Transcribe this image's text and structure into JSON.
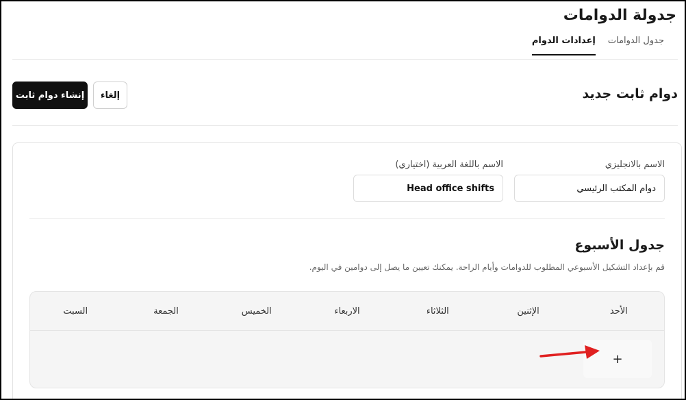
{
  "header": {
    "title": "جدولة الدوامات",
    "tabs": [
      {
        "label": "جدول الدوامات",
        "active": false
      },
      {
        "label": "إعدادات الدوام",
        "active": true
      }
    ]
  },
  "section": {
    "title": "دوام ثابت جديد",
    "create_label": "إنشاء دوام ثابت",
    "cancel_label": "إلغاء"
  },
  "form": {
    "english_name": {
      "label": "الاسم بالانجليزي",
      "value": "دوام المكتب الرئيسي"
    },
    "arabic_name": {
      "label": "الاسم باللغة العربية (اختياري)",
      "value": "Head office shifts"
    }
  },
  "week": {
    "title": "جدول الأسبوع",
    "description": "قم بإعداد التشكيل الأسبوعي المطلوب للدوامات وأيام الراحة. يمكنك تعيين ما يصل إلى دوامين في اليوم.",
    "days": [
      "الأحد",
      "الإثنين",
      "الثلاثاء",
      "الاربعاء",
      "الخميس",
      "الجمعة",
      "السبت"
    ],
    "add_symbol": "+"
  },
  "colors": {
    "primary": "#111111",
    "arrow": "#e02020",
    "table_bg": "#f5f5f5"
  }
}
